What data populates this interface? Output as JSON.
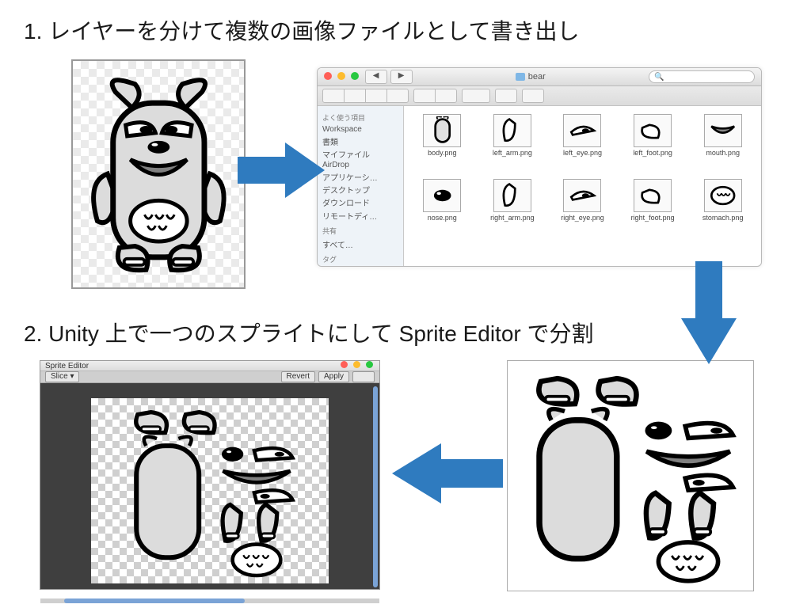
{
  "headings": {
    "step1": "1. レイヤーを分けて複数の画像ファイルとして書き出し",
    "step2": "2. Unity 上で一つのスプライトにして Sprite Editor で分割"
  },
  "finder": {
    "title": "bear",
    "search_placeholder": "",
    "search_icon": "🔍",
    "nav": {
      "back": "◀",
      "forward": "▶"
    },
    "sidebar": {
      "favorites_header": "よく使う項目",
      "items": [
        "Workspace",
        "書類",
        "マイファイル",
        "AirDrop",
        "アプリケーシ…",
        "デスクトップ",
        "ダウンロード",
        "リモートディ…"
      ],
      "shared_header": "共有",
      "shared_items": [
        "すべて…"
      ],
      "tag_header": "タグ"
    },
    "files": [
      {
        "name": "body.png",
        "icon": "body"
      },
      {
        "name": "left_arm.png",
        "icon": "arm"
      },
      {
        "name": "left_eye.png",
        "icon": "eye"
      },
      {
        "name": "left_foot.png",
        "icon": "foot"
      },
      {
        "name": "mouth.png",
        "icon": "mouth"
      },
      {
        "name": "nose.png",
        "icon": "nose"
      },
      {
        "name": "right_arm.png",
        "icon": "arm"
      },
      {
        "name": "right_eye.png",
        "icon": "eye"
      },
      {
        "name": "right_foot.png",
        "icon": "foot"
      },
      {
        "name": "stomach.png",
        "icon": "stomach"
      }
    ]
  },
  "editor": {
    "title": "Sprite Editor",
    "slice": "Slice ▾",
    "revert": "Revert",
    "apply": "Apply"
  },
  "colors": {
    "arrow": "#2f7bbf"
  }
}
